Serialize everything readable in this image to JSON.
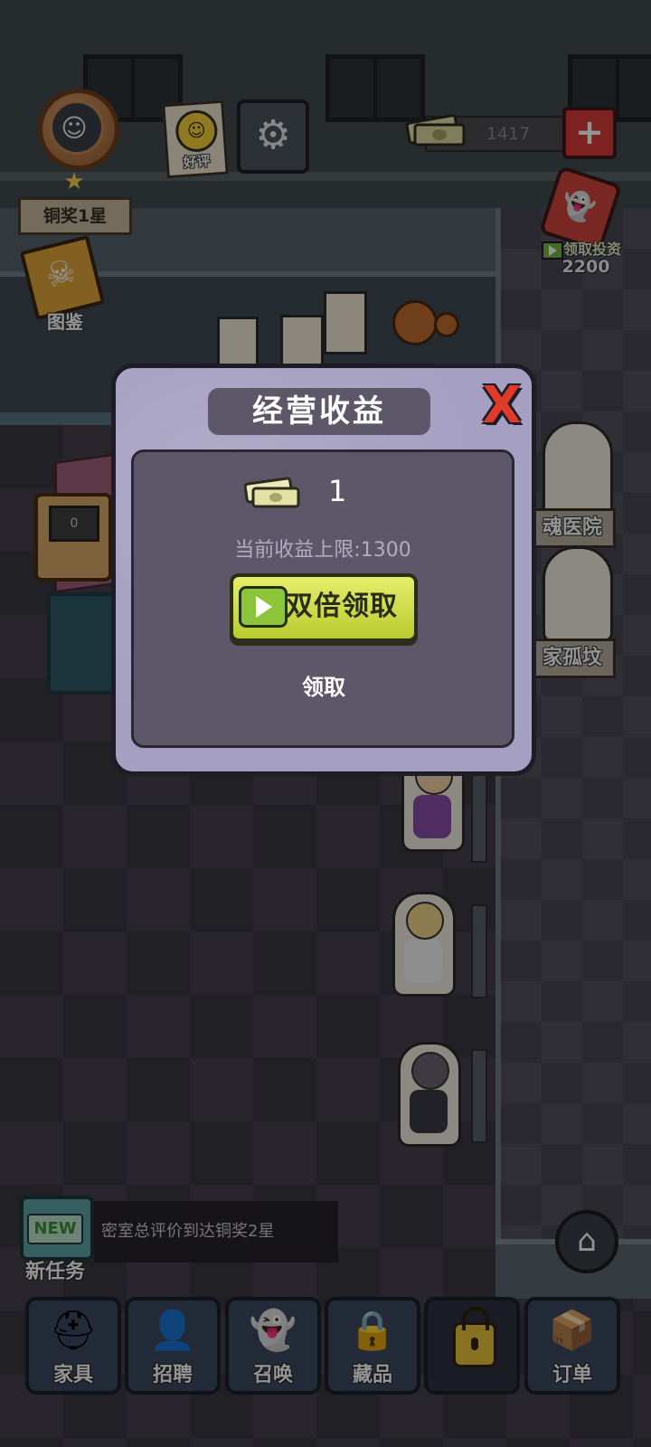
{
  "hud": {
    "rank_label": "铜奖1星",
    "review_label": "好评",
    "cash_amount": "1417",
    "invest_label": "领取投资",
    "invest_amount": "2200",
    "atlas_label": "图鉴"
  },
  "rooms": {
    "tag_1": "魂医院",
    "tag_2": "家孤坟",
    "tv_value": "0"
  },
  "dialog": {
    "title": "经营收益",
    "close_glyph": "X",
    "income_value": "1",
    "cap_text": "当前收益上限:1300",
    "double_button_label": "双倍领取",
    "claim_button_label": "领取"
  },
  "task": {
    "new_badge": "NEW",
    "label": "新任务",
    "description": "密室总评价到达铜奖2星"
  },
  "nav": [
    {
      "label": "家具",
      "icon": "hardhat-icon"
    },
    {
      "label": "招聘",
      "icon": "id-card-icon"
    },
    {
      "label": "召唤",
      "icon": "ghost-icon"
    },
    {
      "label": "藏品",
      "icon": "safe-icon"
    },
    {
      "label": "",
      "icon": "lock-icon"
    },
    {
      "label": "订单",
      "icon": "bat-box-icon"
    }
  ],
  "colors": {
    "dialog_bg": "#a59fc1",
    "panel_bg": "#5d5769",
    "double_button": "#d4e04a",
    "close_red": "#e23a2a"
  }
}
